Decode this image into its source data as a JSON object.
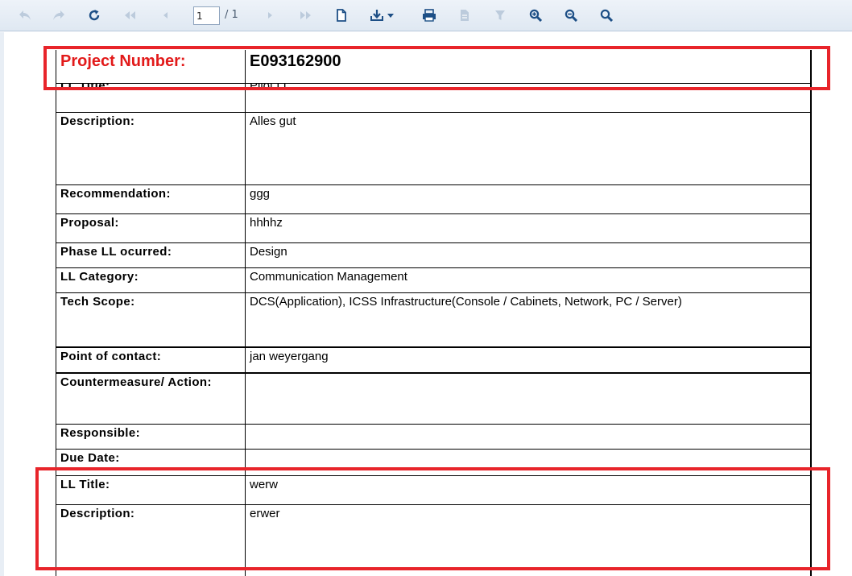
{
  "toolbar": {
    "page_current": "1",
    "page_total": "/ 1",
    "icons": [
      "back-icon",
      "forward-icon",
      "refresh-icon",
      "first-page-icon",
      "previous-page-icon",
      "next-page-icon",
      "last-page-icon",
      "new-document-icon",
      "download-icon",
      "print-icon",
      "export-disabled-icon",
      "filter-icon",
      "zoom-in-icon",
      "zoom-out-icon",
      "zoom-reset-icon"
    ]
  },
  "report": {
    "project_number_label": "Project Number:",
    "project_number_value": "E093162900",
    "rows": [
      {
        "label": "LL Title:",
        "value": "Pilot LL"
      },
      {
        "label": "Description:",
        "value": "Alles gut"
      },
      {
        "label": "Recommendation:",
        "value": "ggg"
      },
      {
        "label": "Proposal:",
        "value": "hhhhz"
      },
      {
        "label": "Phase LL ocurred:",
        "value": "Design"
      },
      {
        "label": "LL Category:",
        "value": "Communication Management"
      },
      {
        "label": "Tech Scope:",
        "value": "DCS(Application), ICSS Infrastructure(Console / Cabinets, Network, PC / Server)"
      },
      {
        "label": "Point of contact:",
        "value": "jan weyergang"
      },
      {
        "label": "Countermeasure/ Action:",
        "value": ""
      },
      {
        "label": "Responsible:",
        "value": ""
      },
      {
        "label": "Due Date:",
        "value": ""
      },
      {
        "label": "LL Title:",
        "value": "werw"
      },
      {
        "label": "Description:",
        "value": "erwer"
      }
    ]
  },
  "colors": {
    "highlight": "#e8242a",
    "project_label": "#e21a1a",
    "toolbar_icon_active": "#1d4f86",
    "toolbar_icon_disabled": "#b8c8da"
  }
}
